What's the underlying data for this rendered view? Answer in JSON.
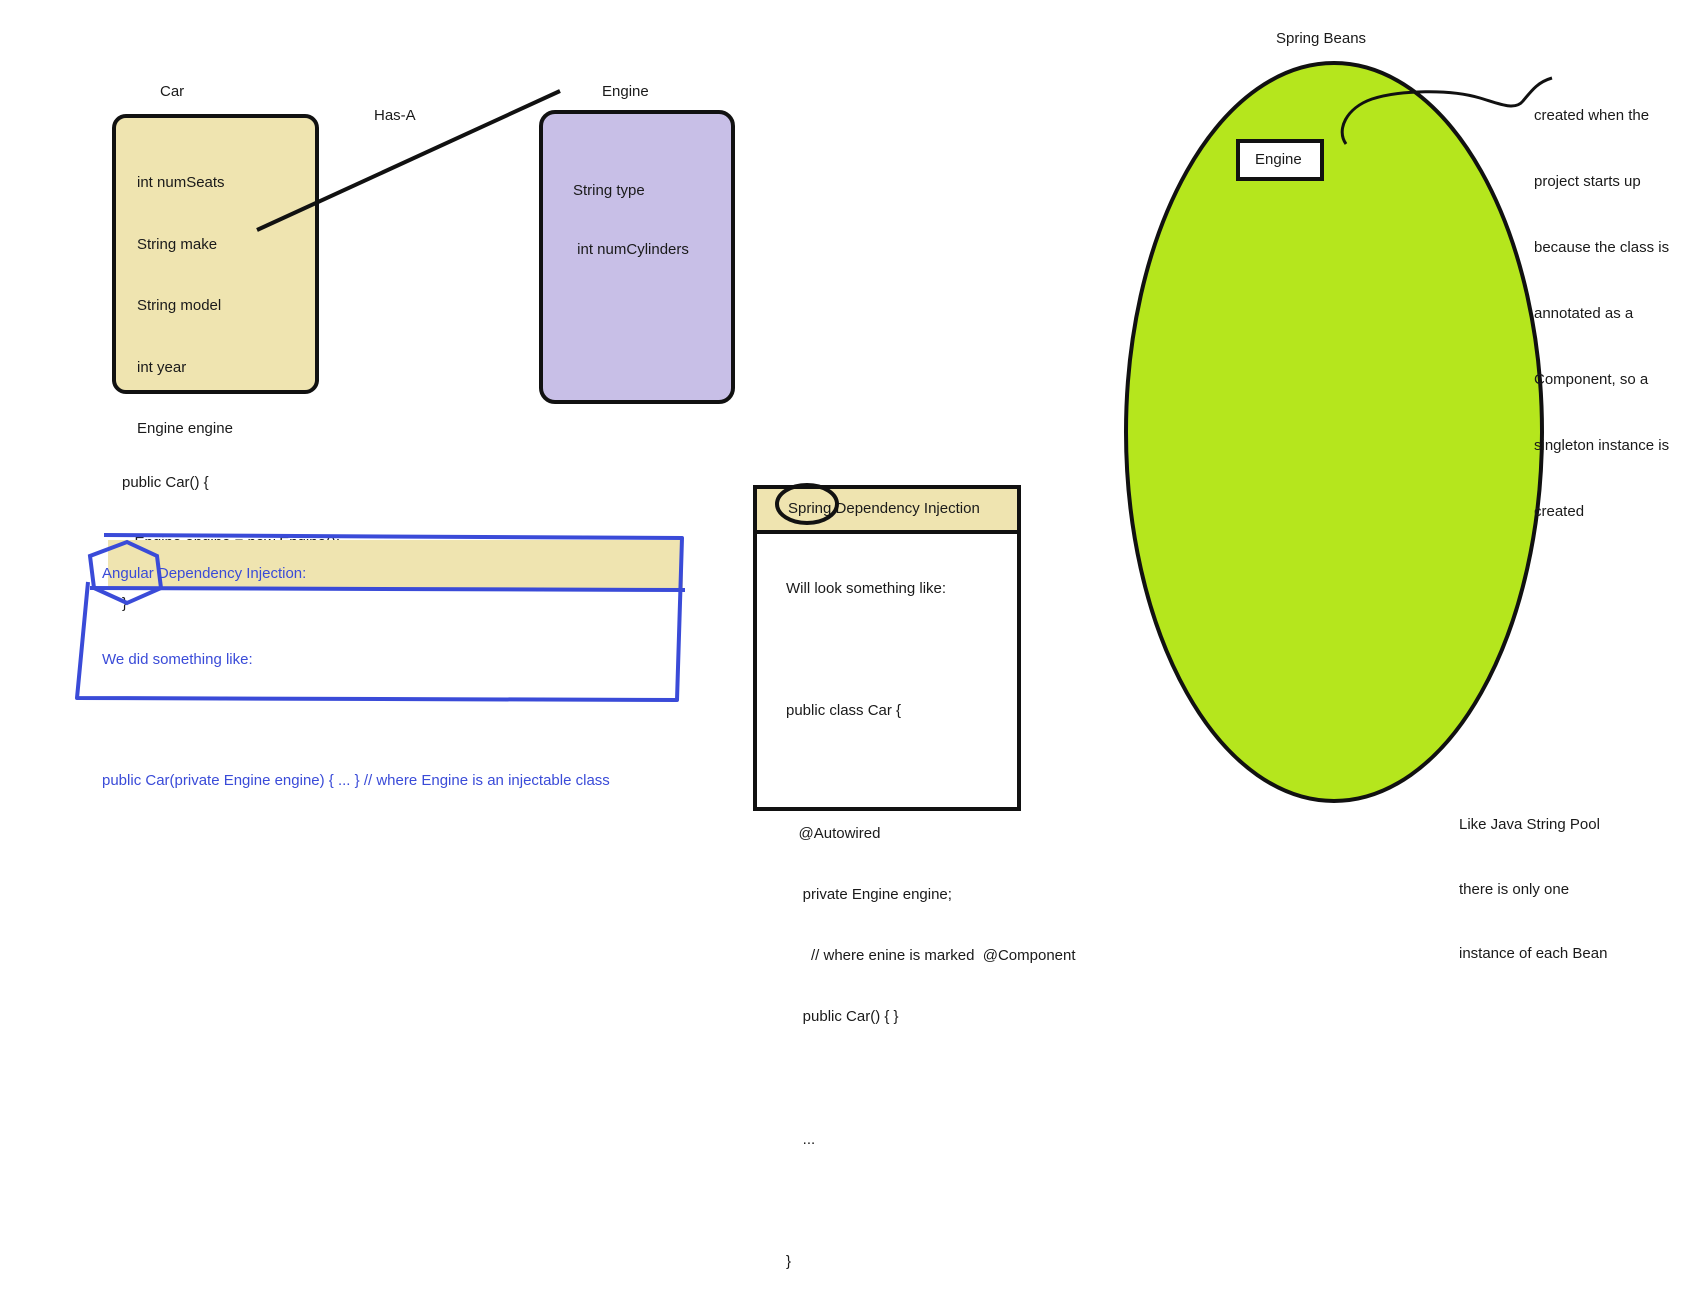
{
  "car": {
    "title": "Car",
    "fields": [
      "int numSeats",
      "String make",
      "String model",
      "int year",
      "Engine engine"
    ]
  },
  "has_a": "Has-A",
  "engine": {
    "title": "Engine",
    "fields": [
      "String type",
      " int numCylinders"
    ]
  },
  "car_constructor": [
    "public Car() {",
    "   Engine engine = new Engine();",
    "}"
  ],
  "angular": {
    "title": "Angular Dependency Injection:",
    "lines": [
      "We did something like:",
      "",
      "public Car(private Engine engine) { ... } // where Engine is an injectable class"
    ]
  },
  "spring": {
    "title": "Spring Dependency Injection",
    "lines": [
      "Will look something like:",
      "",
      "public class Car {",
      "",
      "   @Autowired",
      "    private Engine engine;",
      "      // where enine is marked  @Component",
      "    public Car() { }",
      "",
      "    ...",
      "",
      "}"
    ]
  },
  "beans": {
    "title": "Spring Beans",
    "engine_label": "Engine",
    "note": [
      "created when the",
      "project starts up",
      "because the class is",
      "annotated as a",
      "Component, so a",
      "singleton instance is",
      "created"
    ],
    "pool_note": [
      "Like Java String Pool",
      "there is only one",
      "instance of each Bean"
    ]
  },
  "colors": {
    "car_fill": "#efe4b0",
    "engine_fill": "#c8bfe7",
    "beans_fill": "#b5e61d",
    "angular_header_fill": "#efe4b0",
    "spring_header_fill": "#efe4b0",
    "annotation_blue": "#3a4bd8"
  }
}
